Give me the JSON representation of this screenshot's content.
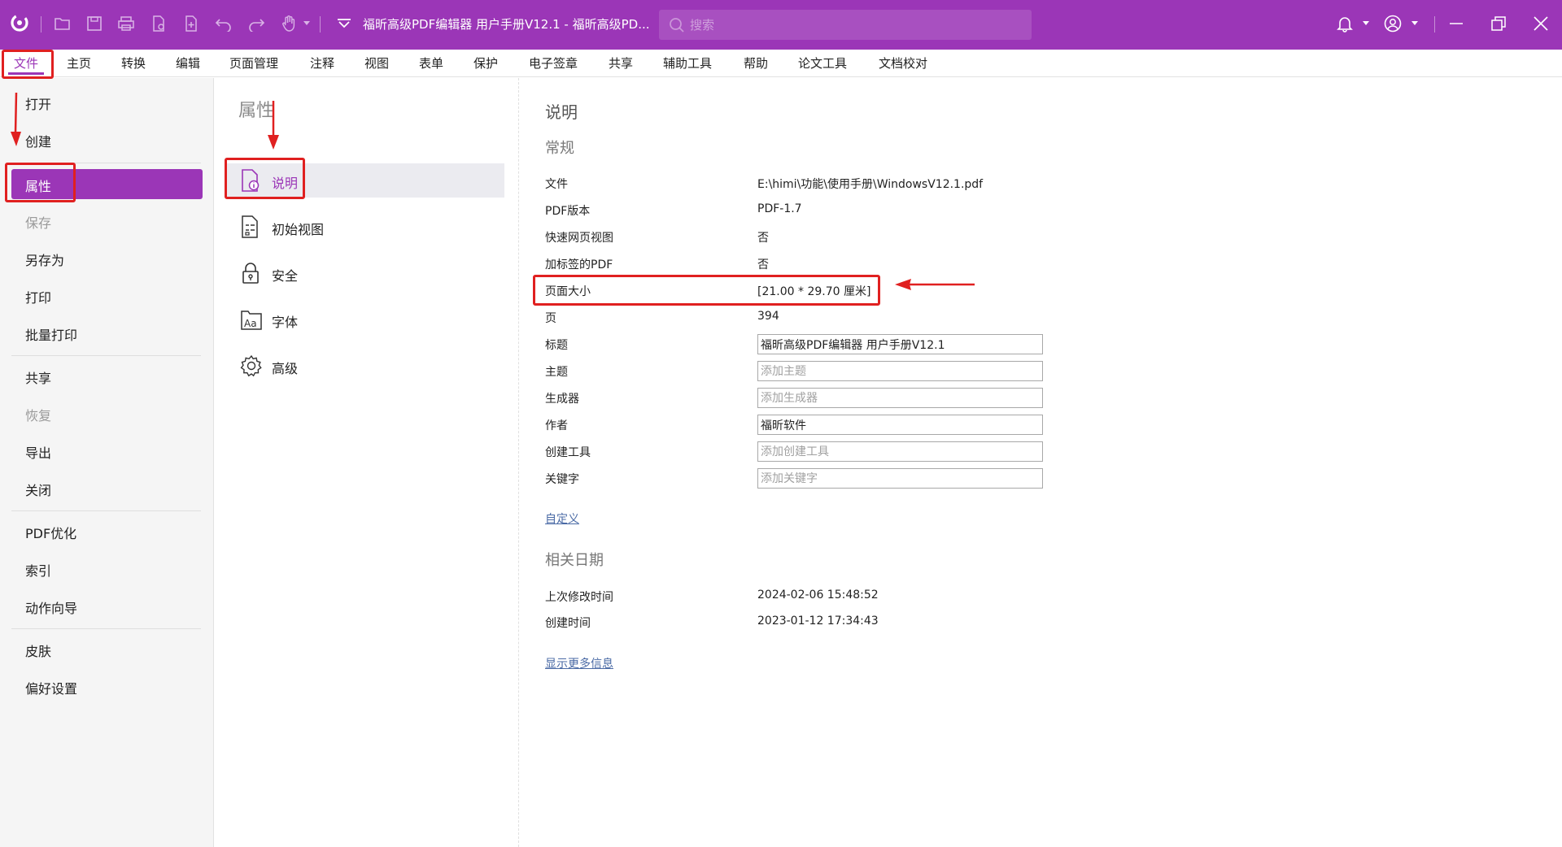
{
  "titlebar": {
    "document_title": "福昕高级PDF编辑器 用户手册V12.1 - 福昕高级PD...",
    "search_placeholder": "搜索",
    "accent": "#9b36b7"
  },
  "menubar": {
    "items": [
      "文件",
      "主页",
      "转换",
      "编辑",
      "页面管理",
      "注释",
      "视图",
      "表单",
      "保护",
      "电子签章",
      "共享",
      "辅助工具",
      "帮助",
      "论文工具",
      "文档校对"
    ],
    "active": "文件"
  },
  "leftnav": {
    "items": [
      {
        "label": "打开",
        "disabled": false
      },
      {
        "label": "创建",
        "disabled": false
      },
      {
        "label": "属性",
        "disabled": false,
        "selected": true
      },
      {
        "label": "保存",
        "disabled": true
      },
      {
        "label": "另存为",
        "disabled": false
      },
      {
        "label": "打印",
        "disabled": false
      },
      {
        "label": "批量打印",
        "disabled": false
      },
      {
        "label": "共享",
        "disabled": false
      },
      {
        "label": "恢复",
        "disabled": true
      },
      {
        "label": "导出",
        "disabled": false
      },
      {
        "label": "关闭",
        "disabled": false
      },
      {
        "label": "PDF优化",
        "disabled": false
      },
      {
        "label": "索引",
        "disabled": false
      },
      {
        "label": "动作向导",
        "disabled": false
      },
      {
        "label": "皮肤",
        "disabled": false
      },
      {
        "label": "偏好设置",
        "disabled": false
      }
    ]
  },
  "midpanel": {
    "title": "属性",
    "items": [
      {
        "label": "说明",
        "icon": "document-info-icon",
        "selected": true
      },
      {
        "label": "初始视图",
        "icon": "initial-view-icon"
      },
      {
        "label": "安全",
        "icon": "lock-icon"
      },
      {
        "label": "字体",
        "icon": "font-icon"
      },
      {
        "label": "高级",
        "icon": "gear-icon"
      }
    ]
  },
  "content": {
    "heading": "说明",
    "general_heading": "常规",
    "properties": [
      {
        "label": "文件",
        "value": "E:\\himi\\功能\\使用手册\\WindowsV12.1.pdf"
      },
      {
        "label": "PDF版本",
        "value": "PDF-1.7"
      },
      {
        "label": "快速网页视图",
        "value": "否"
      },
      {
        "label": "加标签的PDF",
        "value": "否"
      },
      {
        "label": "页面大小",
        "value": "[21.00 * 29.70 厘米]"
      },
      {
        "label": "页",
        "value": "394"
      }
    ],
    "fields": [
      {
        "label": "标题",
        "value": "福昕高级PDF编辑器 用户手册V12.1",
        "placeholder": ""
      },
      {
        "label": "主题",
        "value": "",
        "placeholder": "添加主题"
      },
      {
        "label": "生成器",
        "value": "",
        "placeholder": "添加生成器"
      },
      {
        "label": "作者",
        "value": "福昕软件",
        "placeholder": ""
      },
      {
        "label": "创建工具",
        "value": "",
        "placeholder": "添加创建工具"
      },
      {
        "label": "关键字",
        "value": "",
        "placeholder": "添加关键字"
      }
    ],
    "custom_link": "自定义",
    "dates_heading": "相关日期",
    "dates": [
      {
        "label": "上次修改时间",
        "value": "2024-02-06 15:48:52"
      },
      {
        "label": "创建时间",
        "value": "2023-01-12 17:34:43"
      }
    ],
    "more_info_link": "显示更多信息"
  },
  "annotation_color": "#e02020"
}
